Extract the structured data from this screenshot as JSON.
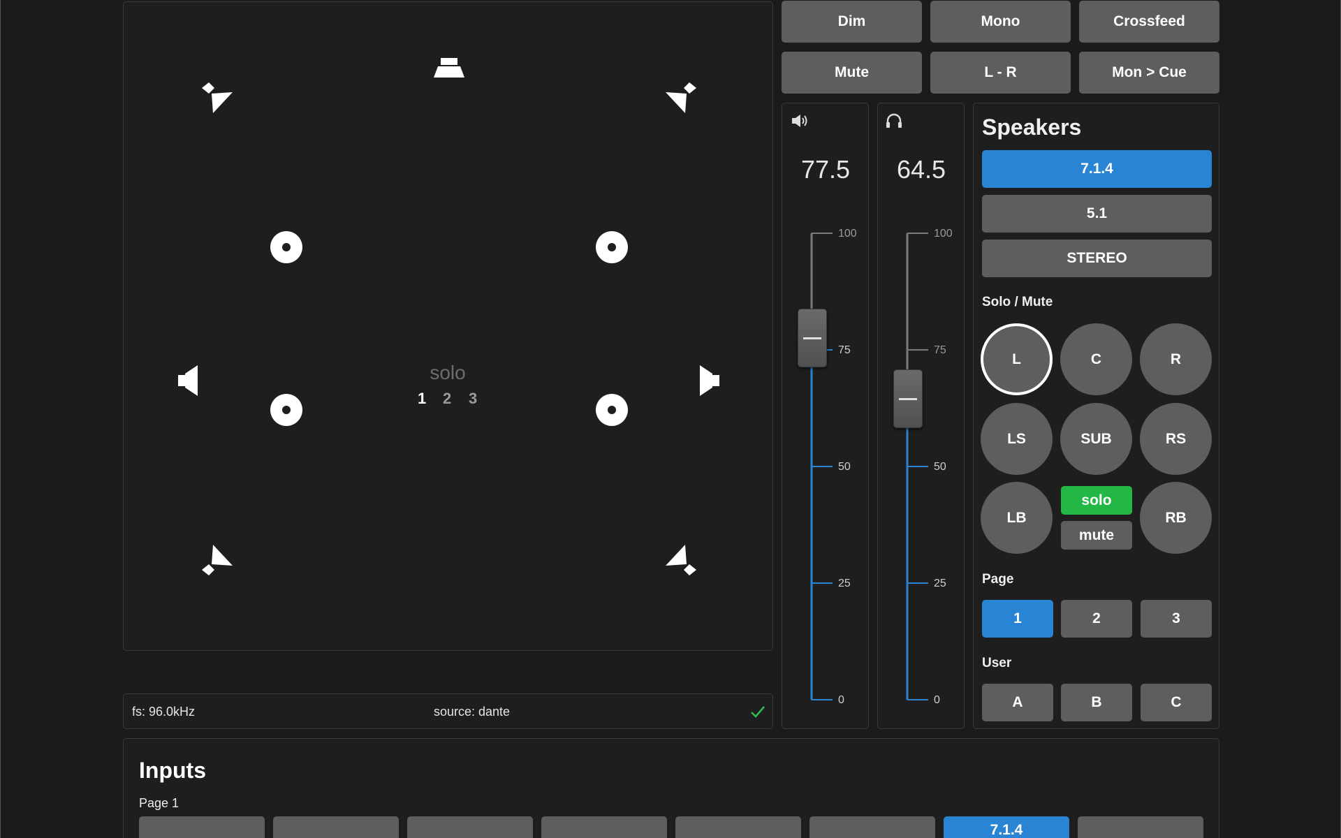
{
  "top_buttons": {
    "dim": "Dim",
    "mono": "Mono",
    "crossfeed": "Crossfeed",
    "mute": "Mute",
    "l_minus_r": "L - R",
    "mon_cue": "Mon > Cue"
  },
  "speaker_map": {
    "solo_label": "solo",
    "solo_pages": [
      "1",
      "2",
      "3"
    ],
    "current_page": "1"
  },
  "status_bar": {
    "sample_rate": "fs: 96.0kHz",
    "source": "source: dante",
    "status_icon": "checkmark-icon",
    "status_color": "#2fbf4f"
  },
  "faders": {
    "monitor": {
      "icon": "speaker-volume-icon",
      "value": "77.5",
      "level": 77.5
    },
    "headphones": {
      "icon": "headphones-icon",
      "value": "64.5",
      "level": 64.5
    },
    "scale": [
      "100",
      "75",
      "50",
      "25",
      "0"
    ],
    "fill_color": "#2a84d4"
  },
  "speakers": {
    "title": "Speakers",
    "configs": [
      "7.1.4",
      "5.1",
      "STEREO"
    ],
    "active_config": "7.1.4",
    "solo_mute_label": "Solo / Mute",
    "channels": [
      "L",
      "C",
      "R",
      "LS",
      "SUB",
      "RS",
      "LB",
      "RB"
    ],
    "selected_channel": "L",
    "solo_label": "solo",
    "mute_label": "mute",
    "page_label": "Page",
    "pages": [
      "1",
      "2",
      "3"
    ],
    "active_page": "1",
    "user_label": "User",
    "users": [
      "A",
      "B",
      "C"
    ]
  },
  "inputs": {
    "title": "Inputs",
    "page_label": "Page 1",
    "active_button_label": "7.1.4"
  },
  "colors": {
    "accent": "#2a84d4",
    "solo_green": "#23b845",
    "button_gray": "#5e5e5e",
    "panel_bg": "#1e1e1e"
  }
}
